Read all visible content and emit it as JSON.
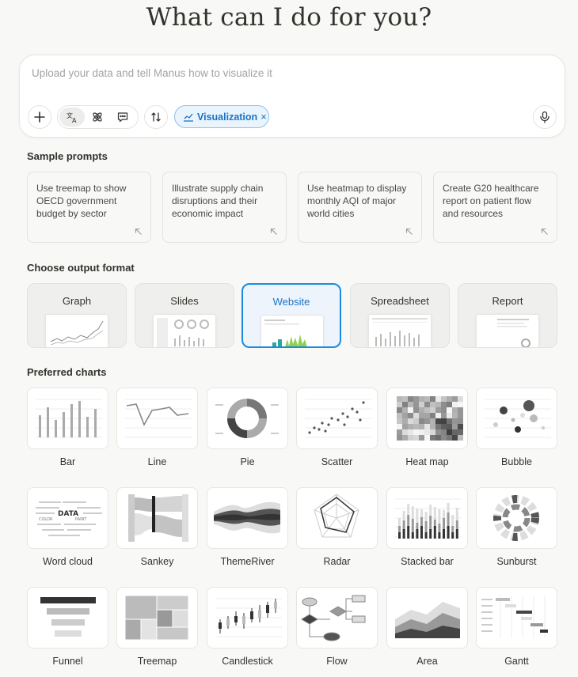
{
  "heading": "What can I do for you?",
  "composer": {
    "placeholder": "Upload your data and tell Manus how to visualize it",
    "chip_label": "Visualization",
    "chip_remove": "×",
    "chip_color": "#1a73c8"
  },
  "sample_prompts": {
    "title": "Sample prompts",
    "items": [
      "Use treemap to show OECD government budget by sector",
      "Illustrate supply chain disruptions and their economic impact",
      "Use heatmap to display monthly AQI of major world cities",
      "Create G20 healthcare report on patient flow and resources"
    ]
  },
  "output_format": {
    "title": "Choose output format",
    "selected": "Website",
    "selected_color": "#1a8be0",
    "items": [
      "Graph",
      "Slides",
      "Website",
      "Spreadsheet",
      "Report"
    ]
  },
  "preferred_charts": {
    "title": "Preferred charts",
    "items": [
      "Bar",
      "Line",
      "Pie",
      "Scatter",
      "Heat map",
      "Bubble",
      "Word cloud",
      "Sankey",
      "ThemeRiver",
      "Radar",
      "Stacked bar",
      "Sunburst",
      "Funnel",
      "Treemap",
      "Candlestick",
      "Flow",
      "Area",
      "Gantt"
    ]
  },
  "icons": [
    "plus-icon",
    "translate-icon",
    "atom-icon",
    "chat-icon",
    "swap-icon",
    "chart-line-icon",
    "close-icon",
    "mic-icon",
    "arrow-up-left-icon"
  ]
}
